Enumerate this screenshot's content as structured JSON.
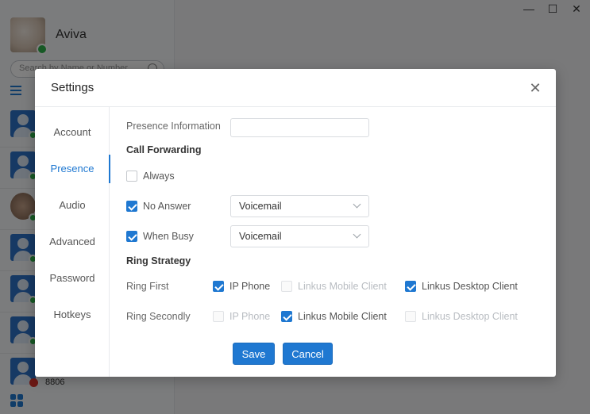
{
  "window": {
    "minimize_glyph": "—",
    "maximize_glyph": "☐",
    "close_glyph": "✕"
  },
  "sidebar": {
    "user_name": "Aviva",
    "search_placeholder": "Search by Name or Number",
    "extension_number": "8806"
  },
  "dialog": {
    "title": "Settings",
    "close_glyph": "✕",
    "nav": [
      {
        "label": "Account"
      },
      {
        "label": "Presence"
      },
      {
        "label": "Audio"
      },
      {
        "label": "Advanced"
      },
      {
        "label": "Password"
      },
      {
        "label": "Hotkeys"
      }
    ],
    "presence": {
      "presence_information_label": "Presence Information",
      "presence_information_value": "",
      "call_forwarding_title": "Call Forwarding",
      "always_label": "Always",
      "always_checked": false,
      "no_answer_label": "No Answer",
      "no_answer_checked": true,
      "no_answer_target": "Voicemail",
      "when_busy_label": "When Busy",
      "when_busy_checked": true,
      "when_busy_target": "Voicemail",
      "ring_strategy_title": "Ring Strategy",
      "ring_first_label": "Ring First",
      "ring_secondly_label": "Ring Secondly",
      "ring_first": [
        {
          "label": "IP Phone",
          "checked": true,
          "enabled": true
        },
        {
          "label": "Linkus Mobile Client",
          "checked": false,
          "enabled": false
        },
        {
          "label": "Linkus Desktop Client",
          "checked": true,
          "enabled": true
        }
      ],
      "ring_secondly": [
        {
          "label": "IP Phone",
          "checked": false,
          "enabled": false
        },
        {
          "label": "Linkus Mobile Client",
          "checked": true,
          "enabled": true
        },
        {
          "label": "Linkus Desktop Client",
          "checked": false,
          "enabled": false
        }
      ]
    },
    "save_label": "Save",
    "cancel_label": "Cancel"
  },
  "colors": {
    "accent": "#1f78d1",
    "online": "#2eb24a",
    "busy": "#d9322b"
  }
}
